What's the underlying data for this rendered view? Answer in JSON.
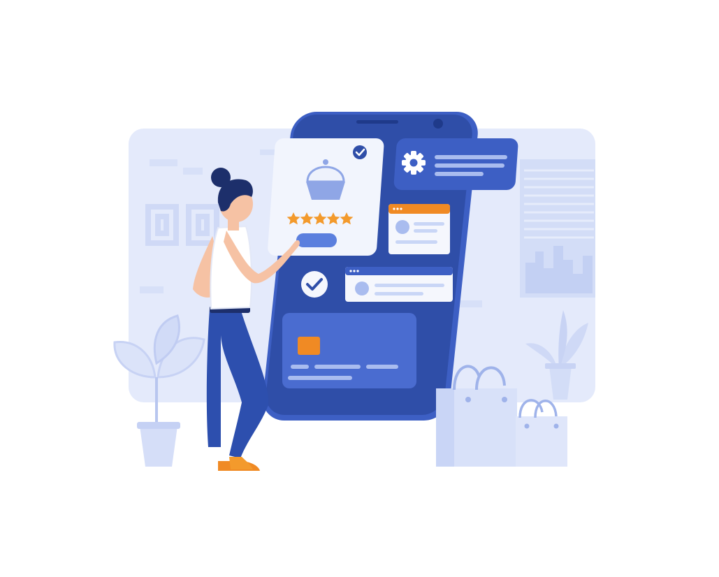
{
  "illustration": {
    "rating": {
      "value": 5,
      "max": 5
    },
    "colors": {
      "background": "#ffffff",
      "backdrop": "#e4eafb",
      "backdrop_detail": "#cfd9f6",
      "phone_body": "#2f4ea8",
      "phone_edge": "#3d5fc4",
      "card_white": "#f5f7fd",
      "card_blue": "#3d5fc4",
      "accent_orange": "#f08a24",
      "star": "#f39a2c",
      "light_blue": "#a9bcef",
      "pale_blue": "#c9d6f6",
      "person_pants": "#2d4fae",
      "person_hair": "#1d2f6b",
      "person_skin": "#f6c2a4",
      "plant": "#d5def8"
    },
    "icons": [
      "gear-icon",
      "check-icon",
      "check-badge-icon",
      "cupcake-icon",
      "star-icon",
      "shopping-bag-icon",
      "plant-icon",
      "window-frame-icon"
    ]
  }
}
